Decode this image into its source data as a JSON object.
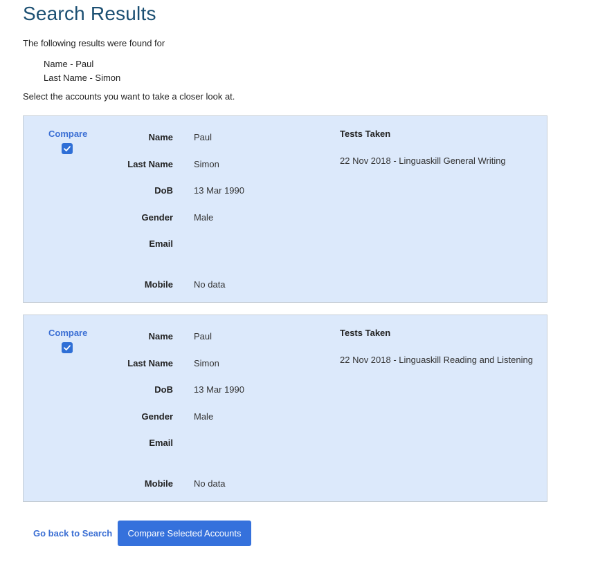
{
  "page": {
    "title": "Search Results",
    "intro": "The following results were found for",
    "criteria": [
      "Name - Paul",
      "Last Name - Simon"
    ],
    "instruction": "Select the accounts you want to take a closer look at."
  },
  "accounts": [
    {
      "compare_label": "Compare",
      "checked": true,
      "labels": {
        "name": "Name",
        "last_name": "Last Name",
        "dob": "DoB",
        "gender": "Gender",
        "email": "Email",
        "mobile": "Mobile"
      },
      "name": "Paul",
      "last_name": "Simon",
      "dob": "13 Mar 1990",
      "gender": "Male",
      "email": "",
      "mobile": "No data",
      "tests_heading": "Tests Taken",
      "tests": [
        "22 Nov 2018 - Linguaskill General Writing"
      ]
    },
    {
      "compare_label": "Compare",
      "checked": true,
      "labels": {
        "name": "Name",
        "last_name": "Last Name",
        "dob": "DoB",
        "gender": "Gender",
        "email": "Email",
        "mobile": "Mobile"
      },
      "name": "Paul",
      "last_name": "Simon",
      "dob": "13 Mar 1990",
      "gender": "Male",
      "email": "",
      "mobile": "No data",
      "tests_heading": "Tests Taken",
      "tests": [
        "22 Nov 2018 - Linguaskill Reading and Listening"
      ]
    }
  ],
  "actions": {
    "back_label": "Go back to Search",
    "compare_label": "Compare Selected Accounts"
  },
  "colors": {
    "title": "#1b4f72",
    "card_bg": "#dce9fb",
    "accent": "#3571dc",
    "link": "#3b6fd4"
  },
  "icons": {
    "checkbox": "checkmark-icon"
  }
}
